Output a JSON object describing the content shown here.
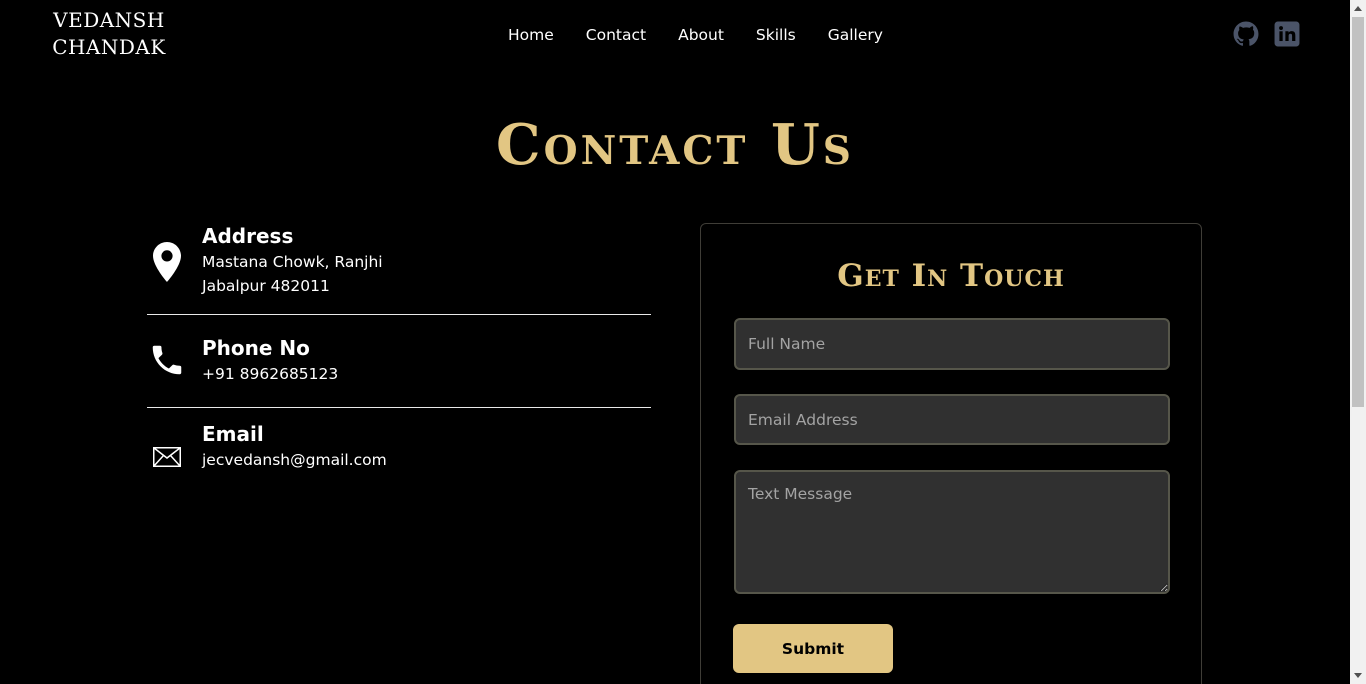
{
  "header": {
    "brand_line1": "VEDANSH",
    "brand_line2": "CHANDAK",
    "nav": [
      "Home",
      "Contact",
      "About",
      "Skills",
      "Gallery"
    ],
    "social": [
      {
        "icon": "github-icon"
      },
      {
        "icon": "linkedin-icon"
      }
    ]
  },
  "page_title": "Contact Us",
  "contact_info": {
    "address": {
      "title": "Address",
      "line1": "Mastana Chowk, Ranjhi",
      "line2": "Jabalpur 482011",
      "icon": "map-pin-icon"
    },
    "phone": {
      "title": "Phone No",
      "value": "+91 8962685123",
      "icon": "phone-icon"
    },
    "email": {
      "title": "Email",
      "value": "jecvedansh@gmail.com",
      "icon": "envelope-icon"
    }
  },
  "form": {
    "title": "Get In Touch",
    "name_placeholder": "Full Name",
    "email_placeholder": "Email Address",
    "message_placeholder": "Text Message",
    "submit_label": "Submit"
  },
  "colors": {
    "accent": "#e2c683",
    "background": "#000000",
    "field_bg": "#303030",
    "social_icon": "#4b5468"
  }
}
